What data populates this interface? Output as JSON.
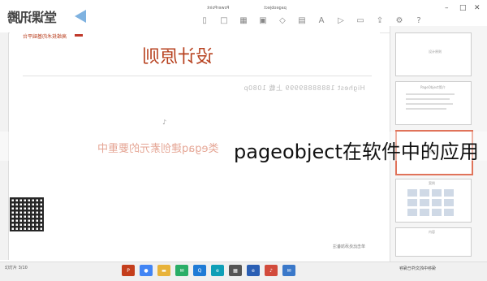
{
  "app": {
    "brand_logo_text": "堂课讯腾",
    "window_title": "PowerPoint",
    "window_title_2": "pageobject"
  },
  "toolbar": {
    "icons": [
      "cursor-icon",
      "box-icon",
      "table-icon",
      "image-icon",
      "shape-icon",
      "chart-icon",
      "text-icon",
      "media-icon",
      "comment-icon",
      "share-icon",
      "settings-icon",
      "help-icon"
    ]
  },
  "slide": {
    "header_small": "高维技术的基础平台",
    "title": "设计原则",
    "watermark": "Highest 18888889999 上载  1080p",
    "subline": "类egaq建创素元的要重中",
    "page_note": "单击此处添加备注"
  },
  "overlay": {
    "text": "pageobject在软件中的应用"
  },
  "thumbnails": [
    {
      "caption": "设计原则",
      "active": false
    },
    {
      "caption": "PageObject简介",
      "active": false
    },
    {
      "caption": "创建类",
      "active": true
    },
    {
      "caption": "案例",
      "active": false
    },
    {
      "caption": "内容",
      "active": false
    }
  ],
  "statusbar": {
    "left": "幻灯片 3/10",
    "right": "保存中的文件已保存",
    "taskbar_apps": [
      "ppt",
      "chrome",
      "folder",
      "wechat",
      "qq",
      "edge",
      "store",
      "ie",
      "music",
      "mail"
    ]
  },
  "colors": {
    "accent": "#b7411f",
    "subline": "#cf5b3c",
    "thumb_active": "#e0735a"
  }
}
